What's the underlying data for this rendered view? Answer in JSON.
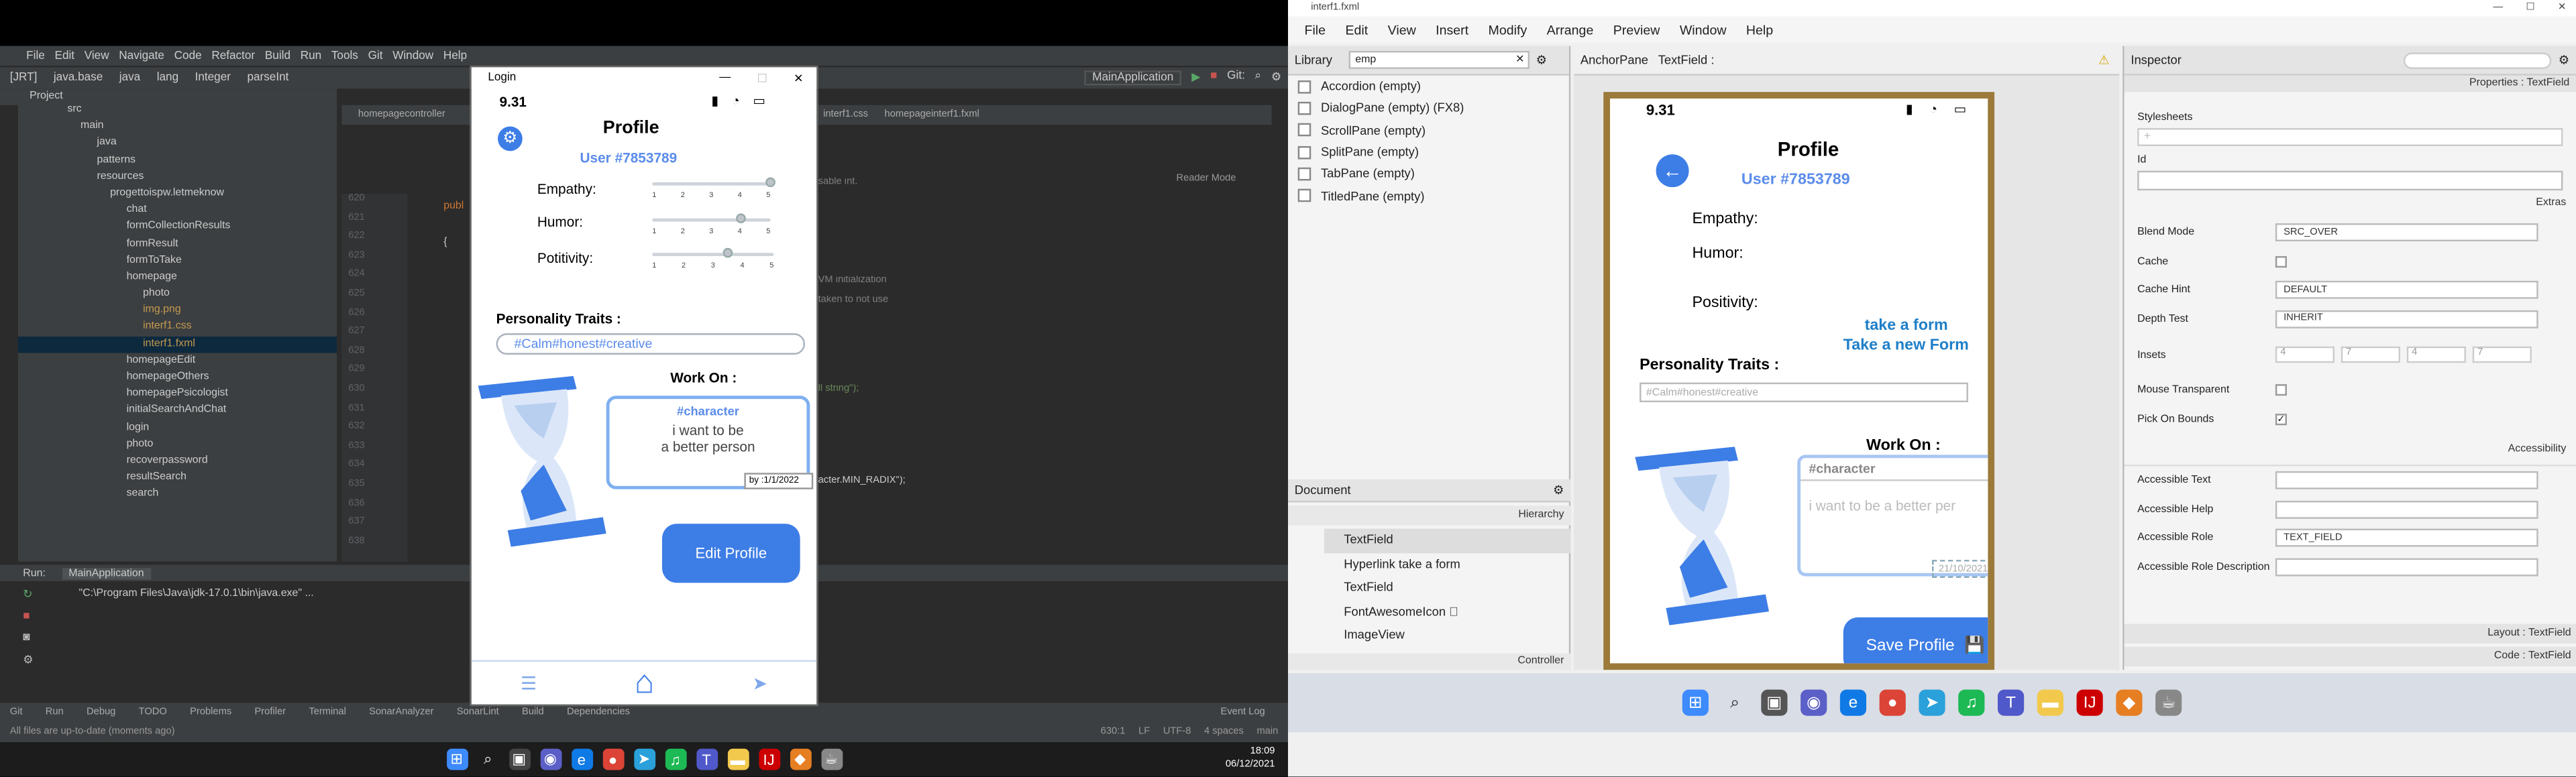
{
  "ide": {
    "menu": [
      "File",
      "Edit",
      "View",
      "Navigate",
      "Code",
      "Refactor",
      "Build",
      "Run",
      "Tools",
      "Git",
      "Window",
      "Help"
    ],
    "breadcrumbs": [
      "[JRT]",
      "java.base",
      "java",
      "lang",
      "Integer",
      "parseInt"
    ],
    "project_label": "Project",
    "tree": [
      "src",
      "main",
      "java",
      "patterns",
      "resources",
      "progettoispw.letmeknow",
      "chat",
      "formCollectionResults",
      "formResult",
      "formToTake",
      "homepage",
      "photo",
      "img.png",
      "interf1.css",
      "interf1.fxml",
      "homepageEdit",
      "homepageOthers",
      "homepagePsicologist",
      "initialSearchAndChat",
      "login",
      "photo",
      "recoverpassword",
      "resultSearch",
      "search"
    ],
    "editor_tabs": [
      "homepagecontroller",
      "interf1.css",
      "homepageinterf1.fxml"
    ],
    "run_config": "MainApplication",
    "git_label": "Git:",
    "reader_mode": "Reader Mode",
    "line_numbers": [
      "620",
      "621",
      "622",
      "623",
      "624",
      "625",
      "626",
      "627",
      "628",
      "629",
      "630",
      "631",
      "632",
      "633",
      "634",
      "635",
      "636",
      "637",
      "638"
    ],
    "code_snippets": [
      "publ",
      "{",
      "sable int.",
      "VM initialization",
      "taken to not use",
      "ll string\");",
      "acter.MIN_RADIX\");"
    ],
    "run_label": "Run:",
    "run_tab": "MainApplication",
    "run_cmd": "\"C:\\Program Files\\Java\\jdk-17.0.1\\bin\\java.exe\" ...",
    "bottom_tools": [
      "Git",
      "Run",
      "TODO",
      "Problems",
      "Profiler",
      "Terminal",
      "SonarAnalyzer",
      "SonarLint",
      "Build",
      "Dependencies"
    ],
    "debug_label": "Debug",
    "event_log": "Event Log",
    "status_msg": "All files are up-to-date (moments ago)",
    "status_right": [
      "630:1",
      "LF",
      "UTF-8",
      "4 spaces",
      "main"
    ]
  },
  "login_window": {
    "title": "Login",
    "time": "9.31",
    "profile_title": "Profile",
    "user_id": "User #7853789",
    "sliders": [
      {
        "label": "Empathy:",
        "value": 5
      },
      {
        "label": "Humor:",
        "value": 4
      },
      {
        "label": "Potitivity:",
        "value": 3.5
      }
    ],
    "ticks": [
      "1",
      "2",
      "3",
      "4",
      "5"
    ],
    "traits_label": "Personality Traits :",
    "traits_value": "#Calm#honest#creative",
    "work_on_label": "Work On :",
    "work_tag": "#character",
    "work_text1": "i want to be",
    "work_text2": "a better person",
    "work_date": "by :1/1/2022",
    "edit_button": "Edit Profile"
  },
  "taskbar_left": {
    "time": "18:09",
    "date": "06/12/2021"
  },
  "scenebuilder": {
    "window_title": "interf1.fxml",
    "menu": [
      "File",
      "Edit",
      "View",
      "Insert",
      "Modify",
      "Arrange",
      "Preview",
      "Window",
      "Help"
    ],
    "library_label": "Library",
    "library_search": "emp",
    "library_items": [
      "Accordion  (empty)",
      "DialogPane (empty)  (FX8)",
      "ScrollPane  (empty)",
      "SplitPane  (empty)",
      "TabPane  (empty)",
      "TitledPane  (empty)"
    ],
    "breadcrumb": [
      "AnchorPane",
      "TextField :"
    ],
    "document_label": "Document",
    "hierarchy_label": "Hierarchy",
    "hierarchy_items": [
      "TextField",
      "Hyperlink  take a form",
      "TextField",
      "FontAwesomeIcon  \u0000",
      "ImageView"
    ],
    "controller_label": "Controller",
    "inspector_label": "Inspector",
    "properties_label": "Properties : TextField",
    "stylesheets_label": "Stylesheets",
    "id_label": "Id",
    "extras_label": "Extras",
    "blend_mode": {
      "label": "Blend Mode",
      "value": "SRC_OVER"
    },
    "cache_label": "Cache",
    "cache_hint": {
      "label": "Cache Hint",
      "value": "DEFAULT"
    },
    "depth_test": {
      "label": "Depth Test",
      "value": "INHERIT"
    },
    "insets_label": "Insets",
    "insets_values": [
      "4",
      "7",
      "4",
      "7"
    ],
    "mouse_transparent_label": "Mouse Transparent",
    "pick_on_bounds_label": "Pick On Bounds",
    "accessibility_label": "Accessibility",
    "accessible_text_label": "Accessible Text",
    "accessible_help_label": "Accessible Help",
    "accessible_role": {
      "label": "Accessible Role",
      "value": "TEXT_FIELD"
    },
    "accessible_role_desc_label": "Accessible Role Description",
    "layout_label": "Layout : TextField",
    "code_label": "Code : TextField"
  },
  "preview": {
    "time": "9.31",
    "profile_title": "Profile",
    "user_id": "User #7853789",
    "labels": [
      "Empathy:",
      "Humor:",
      "Positivity:"
    ],
    "link1": "take a form",
    "link2": "Take a new Form",
    "traits_label": "Personality Traits :",
    "traits_placeholder": "#Calm#honest#creative",
    "work_on_label": "Work On :",
    "work_tag": "#character",
    "work_text": "i want to be a better per",
    "date_value": "21/10/2021",
    "save_button": "Save Profile"
  },
  "colors": {
    "accent": "#3d7de6",
    "ide_bg": "#2b2b2b",
    "preview_frame": "#9b7a3a"
  }
}
